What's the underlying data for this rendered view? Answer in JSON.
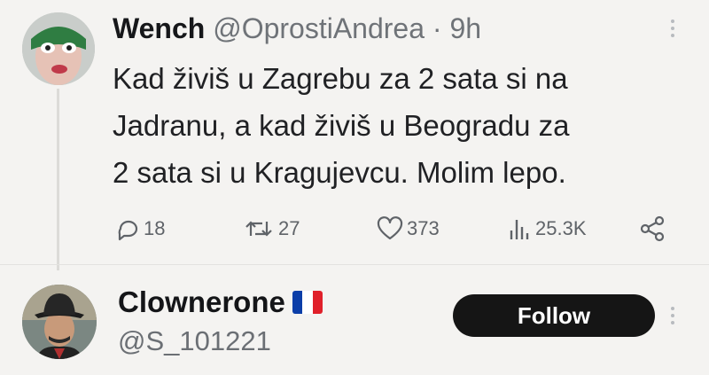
{
  "tweet": {
    "author_name": "Wench",
    "author_handle": "@OprostiAndrea",
    "separator": "·",
    "time": "9h",
    "text_lines": [
      "Kad živiš u Zagrebu za 2 sata si na",
      "Jadranu, a kad živiš u Beogradu za",
      "2 sata si u Kragujevcu. Molim lepo."
    ],
    "replies": "18",
    "retweets": "27",
    "likes": "373",
    "views": "25.3K",
    "icons": [
      "reply-icon",
      "retweet-icon",
      "like-icon",
      "views-icon",
      "share-icon",
      "more-icon"
    ]
  },
  "suggestion": {
    "name": "Clownerone",
    "handle": "@S_101221",
    "follow_label": "Follow",
    "flag_colors": [
      "#0b3ea8",
      "#ffffff",
      "#e0202a"
    ],
    "icons": [
      "avatar",
      "flag-icon",
      "more-icon"
    ]
  },
  "colors": {
    "background": "#f4f3f1",
    "follow_button": "#151515",
    "muted_text": "#6f7378"
  }
}
